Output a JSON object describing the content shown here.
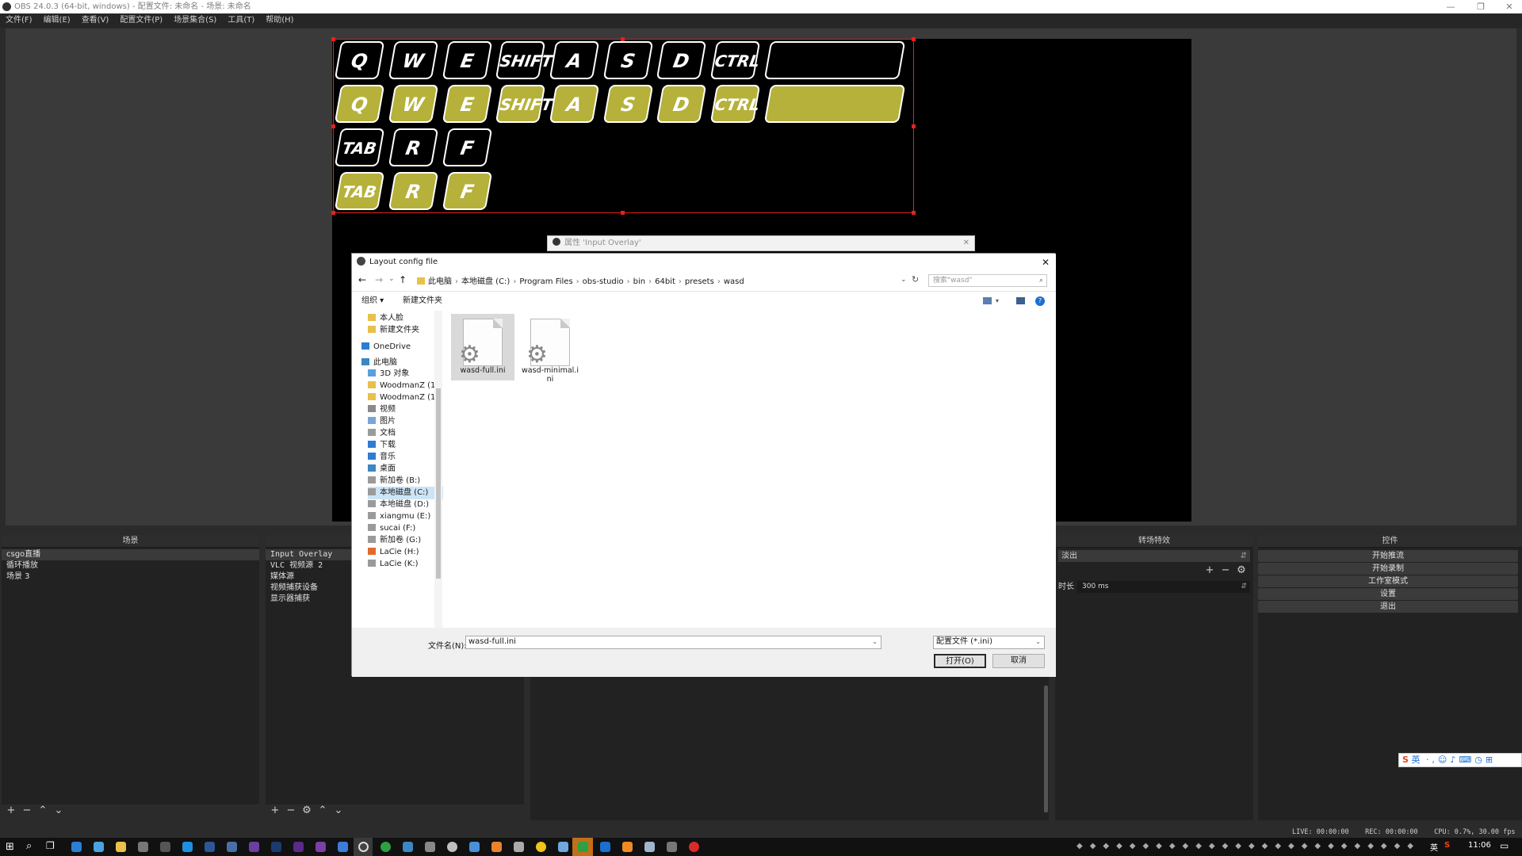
{
  "window": {
    "title": "OBS 24.0.3 (64-bit, windows) - 配置文件: 未命名 - 场景: 未命名"
  },
  "menu": [
    "文件(F)",
    "编辑(E)",
    "查看(V)",
    "配置文件(P)",
    "场景集合(S)",
    "工具(T)",
    "帮助(H)"
  ],
  "overlay_keys": {
    "row1": [
      "Q",
      "W",
      "E",
      "SHIFT",
      "A",
      "S",
      "D",
      "CTRL",
      ""
    ],
    "row2": [
      "Q",
      "W",
      "E",
      "SHIFT",
      "A",
      "S",
      "D",
      "CTRL",
      ""
    ],
    "row3": [
      "TAB",
      "R",
      "F"
    ],
    "row4": [
      "TAB",
      "R",
      "F"
    ]
  },
  "colors": {
    "key_active": "#b5b13a",
    "selection_outline": "#e52020"
  },
  "props_dialog": {
    "title": "属性 'Input Overlay'"
  },
  "file_dialog": {
    "title": "Layout config file",
    "breadcrumbs": [
      "此电脑",
      "本地磁盘 (C:)",
      "Program Files",
      "obs-studio",
      "bin",
      "64bit",
      "presets",
      "wasd"
    ],
    "search_placeholder": "搜索\"wasd\"",
    "organize": "组织 ▾",
    "new_folder": "新建文件夹",
    "nav": [
      "本人脸",
      "新建文件夹",
      "OneDrive",
      "此电脑",
      "3D 对象",
      "WoodmanZ (1!",
      "WoodmanZ (1!",
      "视频",
      "图片",
      "文档",
      "下载",
      "音乐",
      "桌面",
      "新加卷 (B:)",
      "本地磁盘 (C:)",
      "本地磁盘 (D:)",
      "xiangmu (E:)",
      "sucai (F:)",
      "新加卷 (G:)",
      "LaCie (H:)",
      "LaCie (K:)"
    ],
    "files": [
      "wasd-full.ini",
      "wasd-minimal.i\nni"
    ],
    "filename_label": "文件名(N):",
    "filename_value": "wasd-full.ini",
    "filetype_value": "配置文件 (*.ini)",
    "open_button": "打开(O)",
    "cancel_button": "取消"
  },
  "docks": {
    "scenes": {
      "header": "场景",
      "items": [
        "csgo直播",
        "循环播放",
        "场景 3"
      ]
    },
    "sources": {
      "items": [
        "Input Overlay",
        "VLC 视频源 2",
        "媒体源",
        "视频捕获设备",
        "显示器捕获"
      ]
    },
    "transitions": {
      "header": "转场特效",
      "selected": "淡出",
      "duration_label": "时长",
      "duration_value": "300 ms"
    },
    "controls": {
      "header": "控件",
      "buttons": [
        "开始推流",
        "开始录制",
        "工作室模式",
        "设置",
        "退出"
      ]
    }
  },
  "status": {
    "live": "LIVE: 00:00:00",
    "rec": "REC: 00:00:00",
    "cpu": "CPU: 0.7%, 30.00 fps"
  },
  "taskbar": {
    "clock": "11:06",
    "ime": "英"
  }
}
